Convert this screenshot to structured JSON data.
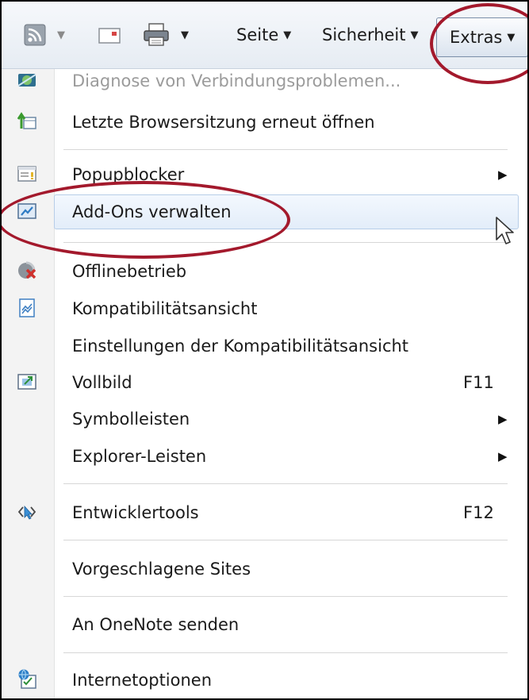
{
  "toolbar": {
    "seite_label": "Seite",
    "sicherheit_label": "Sicherheit",
    "extras_label": "Extras"
  },
  "menu": {
    "items": [
      {
        "label": "Diagnose von Verbindungsproblemen...",
        "icon": "network-diagnose-icon",
        "enabled": false
      },
      {
        "label": "Letzte Browsersitzung erneut öffnen",
        "icon": "reopen-session-icon"
      },
      {
        "label": "Popupblocker",
        "icon": "popup-blocker-icon",
        "submenu": true
      },
      {
        "label": "Add-Ons verwalten",
        "icon": "addons-icon",
        "highlighted": true
      },
      {
        "label": "Offlinebetrieb",
        "icon": "offline-icon"
      },
      {
        "label": "Kompatibilitätsansicht",
        "icon": "compatibility-view-icon"
      },
      {
        "label": "Einstellungen der Kompatibilitätsansicht"
      },
      {
        "label": "Vollbild",
        "icon": "fullscreen-icon",
        "shortcut": "F11"
      },
      {
        "label": "Symbolleisten",
        "submenu": true
      },
      {
        "label": "Explorer-Leisten",
        "submenu": true
      },
      {
        "label": "Entwicklertools",
        "icon": "developer-tools-icon",
        "shortcut": "F12"
      },
      {
        "label": "Vorgeschlagene Sites"
      },
      {
        "label": "An OneNote senden"
      },
      {
        "label": "Internetoptionen",
        "icon": "internet-options-icon"
      }
    ]
  },
  "colors": {
    "annotation_circle": "#a3192c",
    "highlight_border": "#b7cde8",
    "disabled_text": "#9b9b9b"
  }
}
